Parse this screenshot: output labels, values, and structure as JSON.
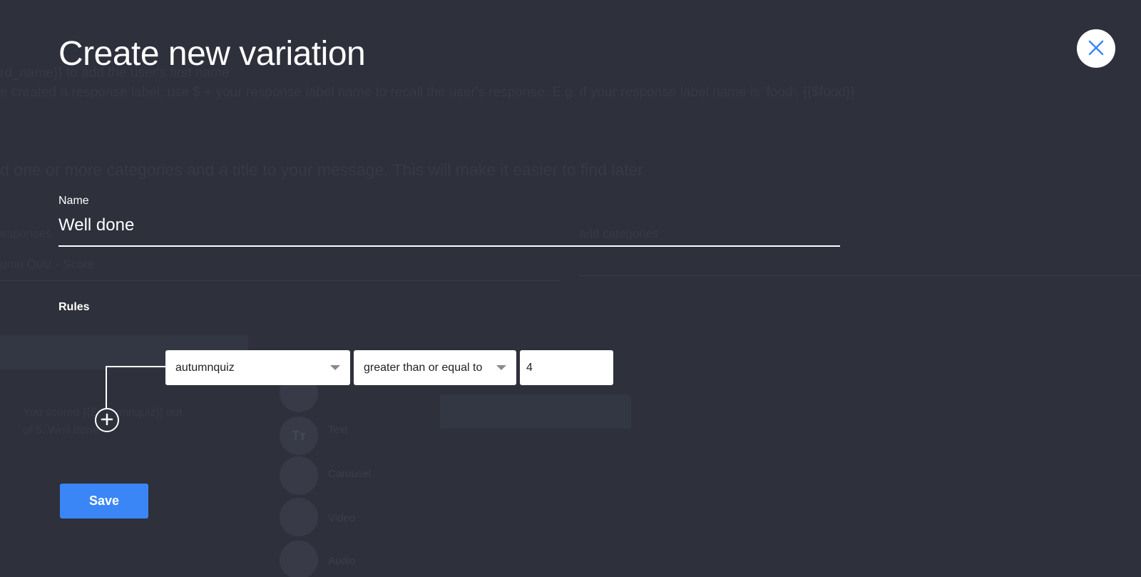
{
  "modal": {
    "title": "Create new variation",
    "close_icon": "close-icon"
  },
  "name_field": {
    "label": "Name",
    "value": "Well done"
  },
  "rules": {
    "label": "Rules",
    "add_icon": "plus-circle-icon",
    "items": [
      {
        "variable": "autumnquiz",
        "operator": "greater than or equal to",
        "value": "4"
      }
    ]
  },
  "actions": {
    "save_label": "Save"
  },
  "colors": {
    "overlay_background": "#2e303b",
    "primary_button": "#3b86f7",
    "close_icon": "#3b86f7",
    "text": "#ffffff"
  },
  "background_page": {
    "line1": "rd_name}} to add the user's first name",
    "line2": "e created a response label, use $ + your response label name to recall the user's response. E.g. if your response label name is 'food', {{$food}}",
    "line3": "d one or more categories and a title to your message. This will make it easier to find later",
    "line4": "esponses",
    "line5": "add categories",
    "line6": "umn Quiz - Score",
    "line7": "You scored {{$autumnquiz}} out of 5. Well done",
    "icon_labels": [
      "Text",
      "Carousel",
      "Video",
      "Audio"
    ]
  }
}
